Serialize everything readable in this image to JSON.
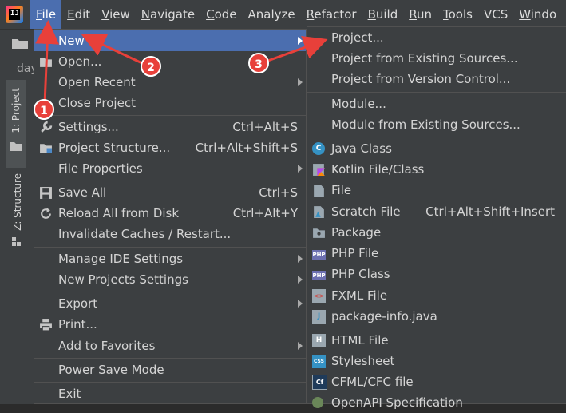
{
  "menubar": {
    "items": [
      {
        "mn": "F",
        "rest": "ile"
      },
      {
        "mn": "E",
        "rest": "dit"
      },
      {
        "mn": "V",
        "rest": "iew"
      },
      {
        "mn": "N",
        "rest": "avigate"
      },
      {
        "mn": "C",
        "rest": "ode"
      },
      {
        "mn": "",
        "rest": "Analyze"
      },
      {
        "mn": "R",
        "rest": "efactor"
      },
      {
        "mn": "B",
        "rest": "uild"
      },
      {
        "mn": "R",
        "rest": "un"
      },
      {
        "mn": "T",
        "rest": "ools"
      },
      {
        "mn": "",
        "rest": "VCS"
      },
      {
        "mn": "W",
        "rest": "indo"
      }
    ]
  },
  "side": {
    "project_tab": "1: Project",
    "structure_tab": "Z: Structure",
    "peek_text": "day"
  },
  "file_menu": {
    "items": [
      {
        "label": "New",
        "shortcut": "",
        "submenu": true,
        "icon": ""
      },
      {
        "label": "Open...",
        "shortcut": "",
        "submenu": false,
        "icon": "open-folder"
      },
      {
        "label": "Open Recent",
        "shortcut": "",
        "submenu": true,
        "icon": ""
      },
      {
        "label": "Close Project",
        "shortcut": "",
        "submenu": false,
        "icon": ""
      },
      {
        "label": "Settings...",
        "shortcut": "Ctrl+Alt+S",
        "submenu": false,
        "icon": "wrench"
      },
      {
        "label": "Project Structure...",
        "shortcut": "Ctrl+Alt+Shift+S",
        "submenu": false,
        "icon": "project-structure"
      },
      {
        "label": "File Properties",
        "shortcut": "",
        "submenu": true,
        "icon": ""
      },
      {
        "label": "Save All",
        "shortcut": "Ctrl+S",
        "submenu": false,
        "icon": "floppy"
      },
      {
        "label": "Reload All from Disk",
        "shortcut": "Ctrl+Alt+Y",
        "submenu": false,
        "icon": "reload"
      },
      {
        "label": "Invalidate Caches / Restart...",
        "shortcut": "",
        "submenu": false,
        "icon": ""
      },
      {
        "label": "Manage IDE Settings",
        "shortcut": "",
        "submenu": true,
        "icon": ""
      },
      {
        "label": "New Projects Settings",
        "shortcut": "",
        "submenu": true,
        "icon": ""
      },
      {
        "label": "Export",
        "shortcut": "",
        "submenu": true,
        "icon": ""
      },
      {
        "label": "Print...",
        "shortcut": "",
        "submenu": false,
        "icon": "printer"
      },
      {
        "label": "Add to Favorites",
        "shortcut": "",
        "submenu": true,
        "icon": ""
      },
      {
        "label": "Power Save Mode",
        "shortcut": "",
        "submenu": false,
        "icon": ""
      },
      {
        "label": "Exit",
        "shortcut": "",
        "submenu": false,
        "icon": ""
      }
    ]
  },
  "new_menu": {
    "items": [
      {
        "label": "Project...",
        "shortcut": "",
        "icon": ""
      },
      {
        "label": "Project from Existing Sources...",
        "shortcut": "",
        "icon": ""
      },
      {
        "label": "Project from Version Control...",
        "shortcut": "",
        "icon": ""
      },
      {
        "label": "Module...",
        "shortcut": "",
        "icon": ""
      },
      {
        "label": "Module from Existing Sources...",
        "shortcut": "",
        "icon": ""
      },
      {
        "label": "Java Class",
        "shortcut": "",
        "icon": "java-class"
      },
      {
        "label": "Kotlin File/Class",
        "shortcut": "",
        "icon": "kotlin"
      },
      {
        "label": "File",
        "shortcut": "",
        "icon": "file"
      },
      {
        "label": "Scratch File",
        "shortcut": "Ctrl+Alt+Shift+Insert",
        "icon": "scratch"
      },
      {
        "label": "Package",
        "shortcut": "",
        "icon": "package"
      },
      {
        "label": "PHP File",
        "shortcut": "",
        "icon": "php"
      },
      {
        "label": "PHP Class",
        "shortcut": "",
        "icon": "php"
      },
      {
        "label": "FXML File",
        "shortcut": "",
        "icon": "fxml"
      },
      {
        "label": "package-info.java",
        "shortcut": "",
        "icon": "java-file"
      },
      {
        "label": "HTML File",
        "shortcut": "",
        "icon": "html"
      },
      {
        "label": "Stylesheet",
        "shortcut": "",
        "icon": "css"
      },
      {
        "label": "CFML/CFC file",
        "shortcut": "",
        "icon": "cfml"
      },
      {
        "label": "OpenAPI Specification",
        "shortcut": "",
        "icon": "openapi"
      }
    ]
  },
  "icon_labels": {
    "java_class": "C",
    "php": "PHP",
    "fxml": "<>",
    "java_file": "J",
    "html": "H",
    "css": "CSS",
    "cfml": "Cf"
  },
  "annotations": [
    "1",
    "2",
    "3"
  ],
  "colors": {
    "accent": "#4b6eaf",
    "annotation": "#e8403a",
    "menu_bg": "#3c3f41"
  }
}
